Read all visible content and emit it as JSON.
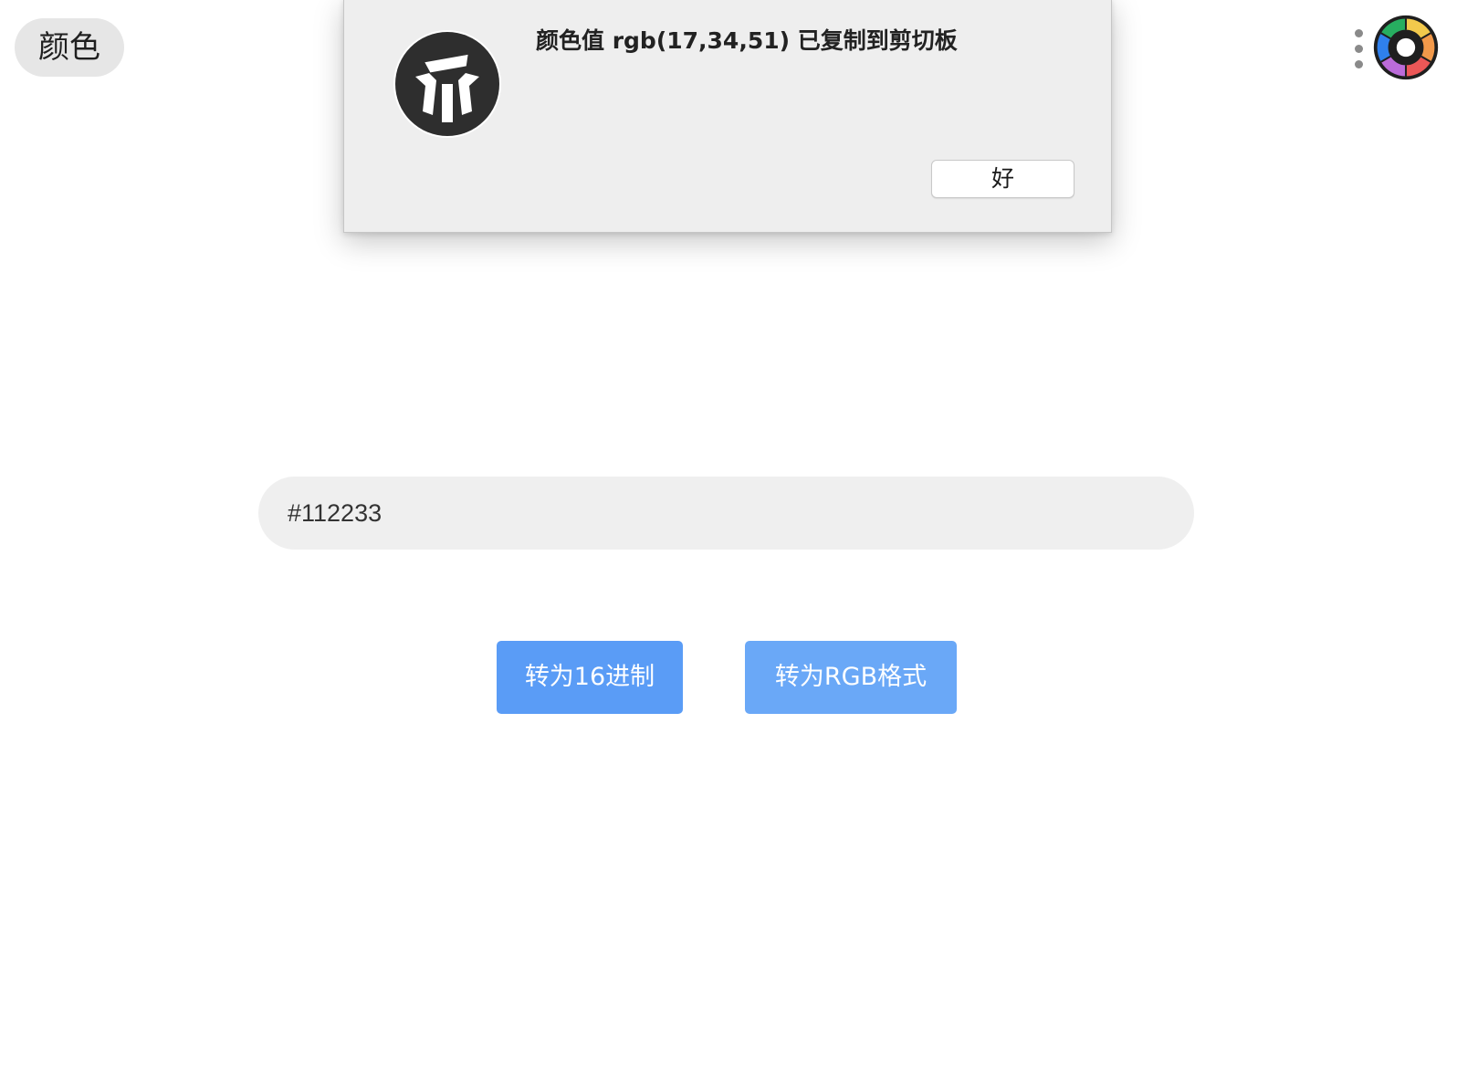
{
  "header": {
    "tag_label": "颜色"
  },
  "alert": {
    "message": "颜色值 rgb(17,34,51) 已复制到剪切板",
    "ok_label": "好",
    "icon": "app-logo-icon"
  },
  "input": {
    "value": "#112233"
  },
  "actions": {
    "to_hex_label": "转为16进制",
    "to_rgb_label": "转为RGB格式"
  },
  "colors": {
    "primary_button": "#5a9cf6",
    "secondary_button": "#6aa8f7",
    "input_background": "#efefef",
    "dialog_background": "#eeeeee"
  }
}
